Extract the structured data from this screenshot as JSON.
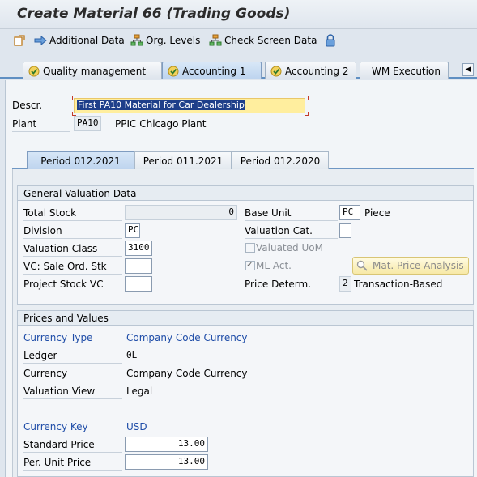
{
  "window": {
    "title": "Create Material 66 (Trading Goods)"
  },
  "toolbar": {
    "additional_data": "Additional Data",
    "org_levels": "Org. Levels",
    "check_screen_data": "Check Screen Data"
  },
  "tabs": [
    {
      "label": "Quality management",
      "checked": true
    },
    {
      "label": "Accounting 1",
      "checked": true,
      "active": true
    },
    {
      "label": "Accounting 2",
      "checked": true
    },
    {
      "label": "WM Execution",
      "checked": false
    }
  ],
  "header": {
    "descr_label": "Descr.",
    "descr_value": "First PA10 Material for Car Dealership",
    "plant_label": "Plant",
    "plant_code": "PA10",
    "plant_name": "PPIC Chicago Plant"
  },
  "subtabs": [
    {
      "label": "Period 012.2021",
      "active": true
    },
    {
      "label": "Period 011.2021"
    },
    {
      "label": "Period 012.2020"
    }
  ],
  "general_valuation": {
    "title": "General Valuation Data",
    "total_stock_label": "Total Stock",
    "total_stock_value": "0",
    "division_label": "Division",
    "division_value": "PC",
    "valuation_class_label": "Valuation Class",
    "valuation_class_value": "3100",
    "vc_sale_ord_label": "VC: Sale Ord. Stk",
    "vc_sale_ord_value": "",
    "project_stock_label": "Project Stock VC",
    "project_stock_value": "",
    "base_unit_label": "Base Unit",
    "base_unit_value": "PC",
    "base_unit_text": "Piece",
    "valuation_cat_label": "Valuation Cat.",
    "valuation_cat_value": "",
    "valuated_uom_label": "Valuated UoM",
    "valuated_uom_checked": false,
    "ml_act_label": "ML Act.",
    "ml_act_checked": true,
    "mat_price_analysis_label": "Mat. Price Analysis",
    "price_determ_label": "Price Determ.",
    "price_determ_value": "2",
    "price_determ_text": "Transaction-Based"
  },
  "prices_values": {
    "title": "Prices and Values",
    "currency_type_label": "Currency Type",
    "currency_type_value": "Company Code Currency",
    "ledger_label": "Ledger",
    "ledger_value": "0L",
    "currency_label": "Currency",
    "currency_value": "Company Code Currency",
    "valuation_view_label": "Valuation View",
    "valuation_view_value": "Legal",
    "currency_key_label": "Currency Key",
    "currency_key_value": "USD",
    "standard_price_label": "Standard Price",
    "standard_price_value": "13.00",
    "per_unit_price_label": "Per. Unit Price",
    "per_unit_price_value": "13.00"
  },
  "colors": {
    "accent_blue": "#1f4da8",
    "tab_active": "#bcd3ee",
    "selection": "#1e3f8a",
    "descr_highlight": "#ffee9e"
  }
}
